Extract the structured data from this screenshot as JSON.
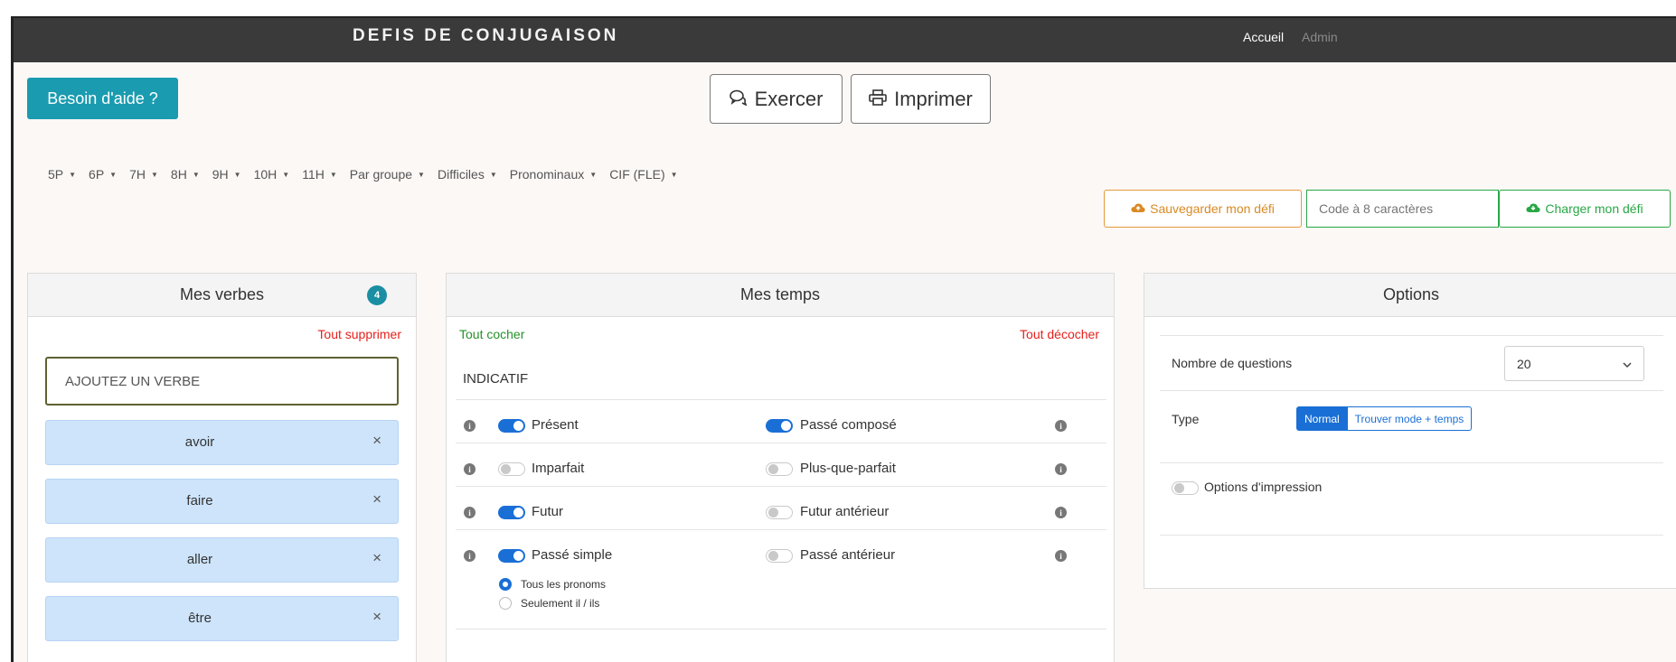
{
  "navbar": {
    "brand": "DEFIS DE CONJUGAISON",
    "links": {
      "accueil": "Accueil",
      "admin": "Admin"
    }
  },
  "toolbar": {
    "help_label": "Besoin d'aide ?",
    "exercer_label": "Exercer",
    "imprimer_label": "Imprimer"
  },
  "levels": [
    "5P",
    "6P",
    "7H",
    "8H",
    "9H",
    "10H",
    "11H",
    "Par groupe",
    "Difficiles",
    "Pronominaux",
    "CIF (FLE)"
  ],
  "save_panel": {
    "save_label": "Sauvegarder mon défi",
    "code_placeholder": "Code à 8 caractères",
    "load_label": "Charger mon défi"
  },
  "verbes": {
    "title": "Mes verbes",
    "count": "4",
    "clear_all": "Tout supprimer",
    "input_placeholder": "AJOUTEZ UN VERBE",
    "items": [
      "avoir",
      "faire",
      "aller",
      "être"
    ],
    "remove_glyph": "×"
  },
  "temps": {
    "title": "Mes temps",
    "check_all": "Tout cocher",
    "uncheck_all": "Tout décocher",
    "category": "INDICATIF",
    "left": [
      {
        "label": "Présent",
        "on": true
      },
      {
        "label": "Imparfait",
        "on": false
      },
      {
        "label": "Futur",
        "on": true
      },
      {
        "label": "Passé simple",
        "on": true
      }
    ],
    "right": [
      {
        "label": "Passé composé",
        "on": true
      },
      {
        "label": "Plus-que-parfait",
        "on": false
      },
      {
        "label": "Futur antérieur",
        "on": false
      },
      {
        "label": "Passé antérieur",
        "on": false
      }
    ],
    "pronoun_options": [
      {
        "label": "Tous les pronoms",
        "selected": true
      },
      {
        "label": "Seulement il / ils",
        "selected": false
      }
    ]
  },
  "options": {
    "title": "Options",
    "questions_label": "Nombre de questions",
    "questions_value": "20",
    "type_label": "Type",
    "type_options": [
      "Normal",
      "Trouver mode + temps"
    ],
    "type_selected": "Normal",
    "print_options_label": "Options d'impression",
    "print_options_on": false
  },
  "colors": {
    "navbar_bg": "#3a3a3a",
    "help_btn": "#1a9bb0",
    "toggle_on": "#1a6fd6",
    "verb_chip": "#cde4fb",
    "danger": "#e5211c",
    "success": "#25902b",
    "warning": "#d98a24"
  }
}
